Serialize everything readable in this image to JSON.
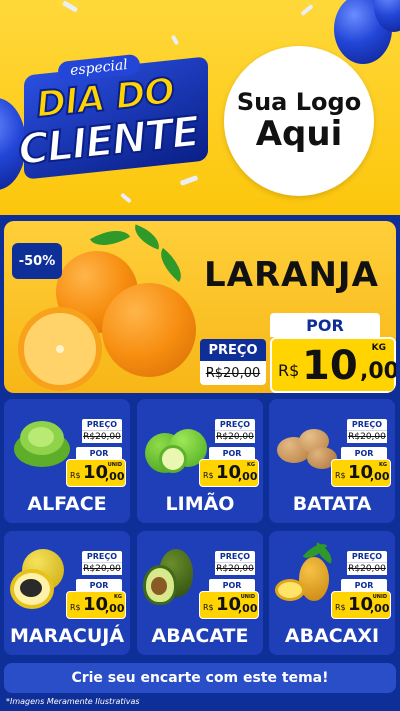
{
  "header": {
    "badge": "especial",
    "title_line1": "DIA DO",
    "title_line2": "CLIENTE",
    "logo_line1": "Sua Logo",
    "logo_line2": "Aqui"
  },
  "featured": {
    "discount": "-50%",
    "name": "LARANJA",
    "preco_label": "PREÇO",
    "preco_old": "R$20,00",
    "por_label": "POR",
    "currency": "R$",
    "price_int": "10",
    "price_dec": ",00",
    "unit": "KG"
  },
  "products": [
    {
      "name": "ALFACE",
      "preco_label": "PREÇO",
      "preco_old": "R$20,00",
      "por_label": "POR",
      "currency": "R$",
      "price_int": "10",
      "price_dec": ",00",
      "unit": "UNID",
      "icon": "lettuce-icon"
    },
    {
      "name": "LIMÃO",
      "preco_label": "PREÇO",
      "preco_old": "R$20,00",
      "por_label": "POR",
      "currency": "R$",
      "price_int": "10",
      "price_dec": ",00",
      "unit": "KG",
      "icon": "lime-icon"
    },
    {
      "name": "BATATA",
      "preco_label": "PREÇO",
      "preco_old": "R$20,00",
      "por_label": "POR",
      "currency": "R$",
      "price_int": "10",
      "price_dec": ",00",
      "unit": "KG",
      "icon": "potato-icon"
    },
    {
      "name": "MARACUJÁ",
      "preco_label": "PREÇO",
      "preco_old": "R$20,00",
      "por_label": "POR",
      "currency": "R$",
      "price_int": "10",
      "price_dec": ",00",
      "unit": "KG",
      "icon": "passion-fruit-icon"
    },
    {
      "name": "ABACATE",
      "preco_label": "PREÇO",
      "preco_old": "R$20,00",
      "por_label": "POR",
      "currency": "R$",
      "price_int": "10",
      "price_dec": ",00",
      "unit": "UNID",
      "icon": "avocado-icon"
    },
    {
      "name": "ABACAXI",
      "preco_label": "PREÇO",
      "preco_old": "R$20,00",
      "por_label": "POR",
      "currency": "R$",
      "price_int": "10",
      "price_dec": ",00",
      "unit": "UNID",
      "icon": "pineapple-icon"
    }
  ],
  "cta": "Crie seu encarte com este tema!",
  "disclaimer": "*Imagens Meramente Ilustrativas",
  "colors": {
    "header_yellow": "#fcc60c",
    "brand_blue": "#0f2f98",
    "card_blue": "#1e3fb8",
    "price_yellow": "#ffd400"
  }
}
